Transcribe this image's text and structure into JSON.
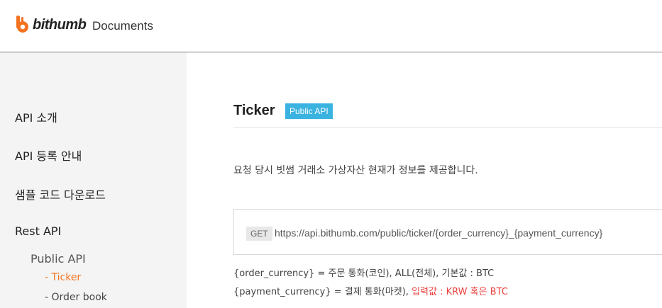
{
  "header": {
    "brand": "bithumb",
    "product": "Documents",
    "brand_color": "#f37321"
  },
  "sidebar": {
    "items": [
      {
        "label": "API 소개"
      },
      {
        "label": "API 등록 안내"
      },
      {
        "label": "샘플 코드 다운로드"
      },
      {
        "label": "Rest API"
      }
    ],
    "sub_group": {
      "label": "Public API"
    },
    "leaves": [
      {
        "label": "- Ticker",
        "active": true
      },
      {
        "label": "- Order book",
        "active": false
      }
    ]
  },
  "main": {
    "title": "Ticker",
    "badge": "Public API",
    "description": "요청 당시 빗썸 거래소 가상자산 현재가 정보를 제공합니다.",
    "endpoint": {
      "method": "GET",
      "url": "https://api.bithumb.com/public/ticker/{order_currency}_{payment_currency}"
    },
    "params": [
      {
        "text": "{order_currency} = 주문 통화(코인), ALL(전체), 기본값 : BTC",
        "highlight": ""
      },
      {
        "text": "{payment_currency} = 결제 통화(마켓), ",
        "highlight": "입력값 : KRW 혹은 BTC"
      }
    ]
  }
}
